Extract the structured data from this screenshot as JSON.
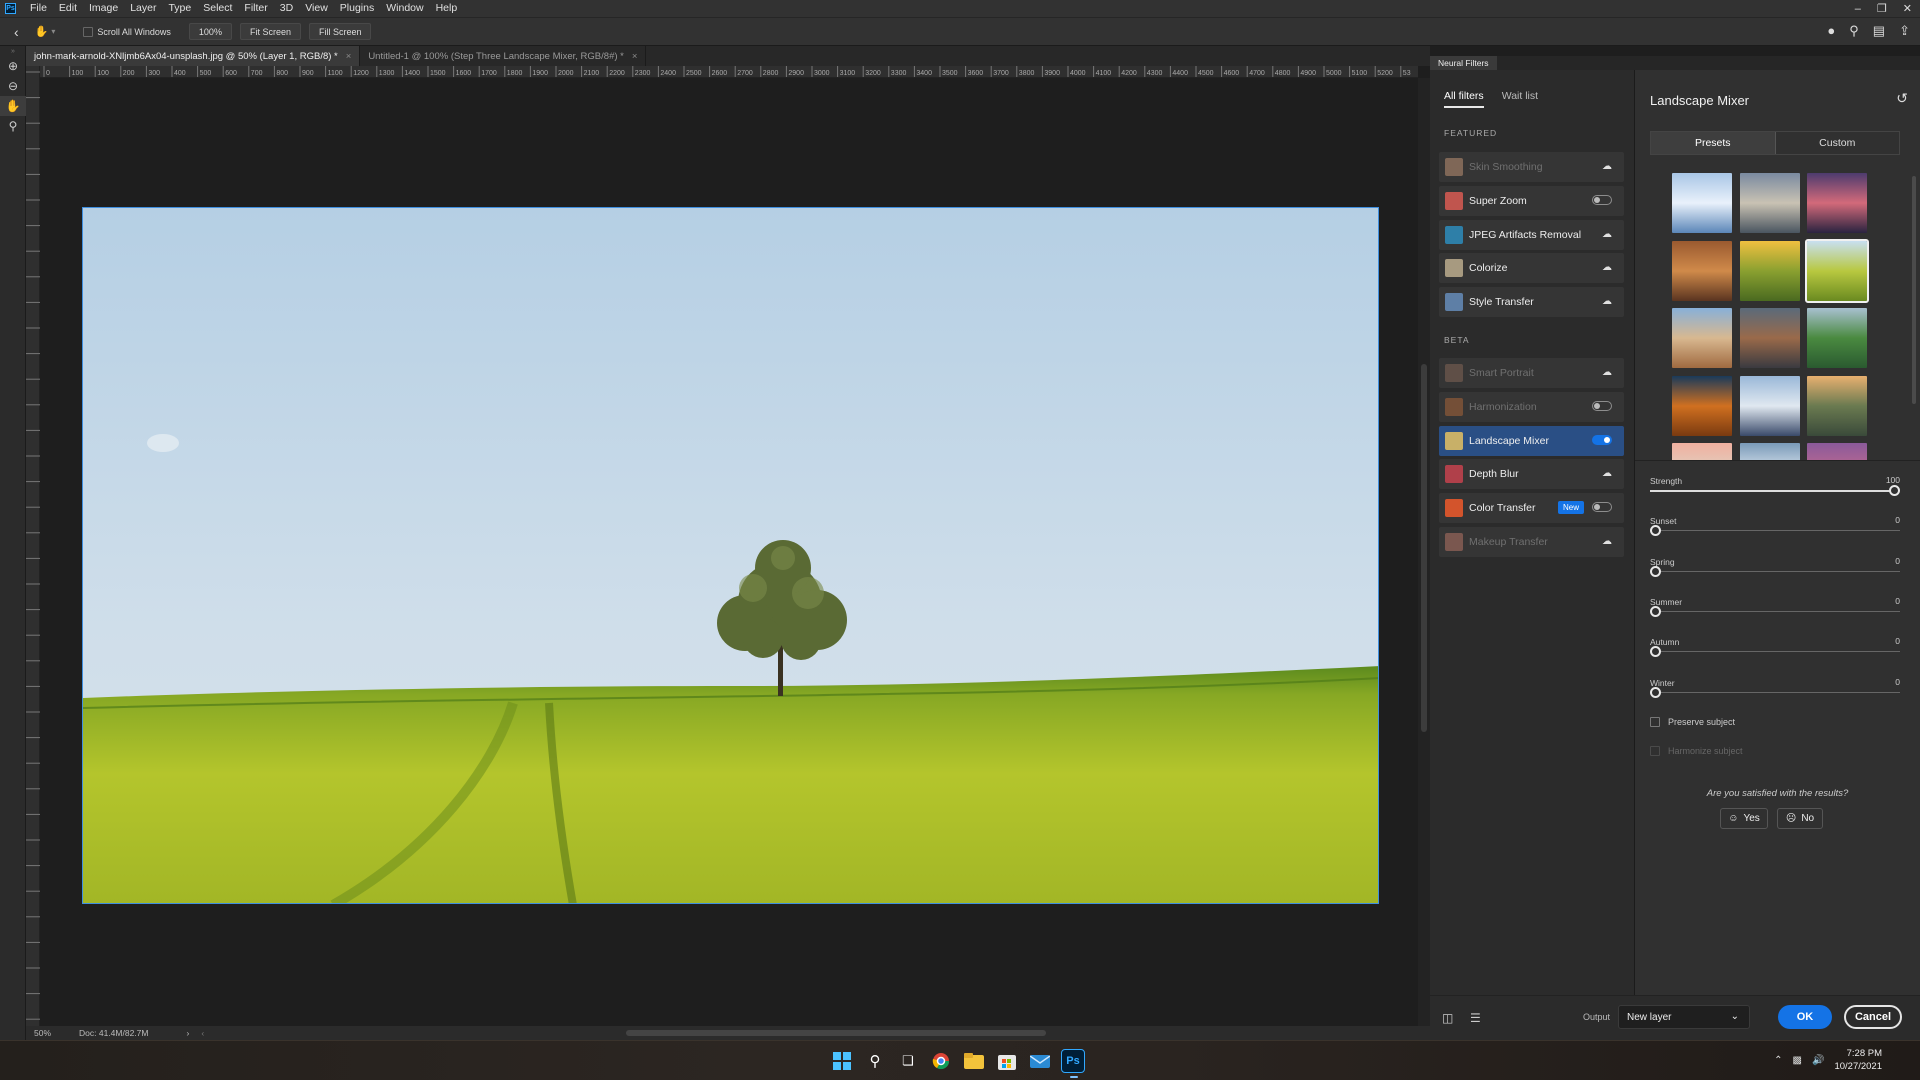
{
  "app": {
    "logo": "Ps",
    "menu": [
      "File",
      "Edit",
      "Image",
      "Layer",
      "Type",
      "Select",
      "Filter",
      "3D",
      "View",
      "Plugins",
      "Window",
      "Help"
    ],
    "window_controls": [
      "minimize-icon",
      "restore-icon",
      "close-icon"
    ]
  },
  "options_bar": {
    "scroll_all_windows": "Scroll All Windows",
    "zoom_value": "100%",
    "fit_screen": "Fit Screen",
    "fill_screen": "Fill Screen"
  },
  "document_tabs": [
    {
      "label": "john-mark-arnold-XNljmb6Ax04-unsplash.jpg @ 50% (Layer 1, RGB/8) *",
      "active": true
    },
    {
      "label": "Untitled-1 @ 100% (Step Three Landscape Mixer, RGB/8#) *",
      "active": false
    }
  ],
  "ruler": {
    "h_ticks": [
      "0",
      "100",
      "100",
      "200",
      "300",
      "400",
      "500",
      "600",
      "700",
      "800",
      "900",
      "1100",
      "1200",
      "1300",
      "1400",
      "1500",
      "1600",
      "1700",
      "1800",
      "1900",
      "2000",
      "2100",
      "2200",
      "2300",
      "2400",
      "2500",
      "2600",
      "2700",
      "2800",
      "2900",
      "3000",
      "3100",
      "3200",
      "3300",
      "3400",
      "3500",
      "3600",
      "3700",
      "3800",
      "3900",
      "4000",
      "4100",
      "4200",
      "4300",
      "4400",
      "4500",
      "4600",
      "4700",
      "4800",
      "4900",
      "5000",
      "5100",
      "5200",
      "53"
    ]
  },
  "status": {
    "zoom": "50%",
    "doc": "Doc: 41.4M/82.7M"
  },
  "neural_filters": {
    "panel_title": "Neural Filters",
    "tabs": {
      "all": "All filters",
      "wait": "Wait list"
    },
    "featured_title": "FEATURED",
    "beta_title": "BETA",
    "featured": [
      {
        "label": "Skin Smoothing",
        "control": "cloud",
        "disabled": true,
        "color": "#c99a7a"
      },
      {
        "label": "Super Zoom",
        "control": "toggle-off",
        "disabled": false,
        "color": "#c0554e"
      },
      {
        "label": "JPEG Artifacts Removal",
        "control": "cloud",
        "disabled": false,
        "color": "#2e7fa8"
      },
      {
        "label": "Colorize",
        "control": "cloud",
        "disabled": false,
        "color": "#a79a80"
      },
      {
        "label": "Style Transfer",
        "control": "cloud",
        "disabled": false,
        "color": "#5e7fa6"
      }
    ],
    "beta": [
      {
        "label": "Smart Portrait",
        "control": "cloud",
        "disabled": true,
        "color": "#8a6a5a"
      },
      {
        "label": "Harmonization",
        "control": "toggle-off",
        "disabled": true,
        "color": "#b46a3a"
      },
      {
        "label": "Landscape Mixer",
        "control": "toggle-on",
        "disabled": false,
        "active": true,
        "color": "#c8b068"
      },
      {
        "label": "Depth Blur",
        "control": "cloud",
        "disabled": false,
        "color": "#b0404a"
      },
      {
        "label": "Color Transfer",
        "control": "toggle-off",
        "disabled": false,
        "badge": "New",
        "color": "#d3542c"
      },
      {
        "label": "Makeup Transfer",
        "control": "cloud",
        "disabled": true,
        "color": "#c07a6a"
      }
    ],
    "settings": {
      "title": "Landscape Mixer",
      "segments": [
        "Presets",
        "Custom"
      ],
      "presets": [
        {
          "colors": [
            "#a9c6e6",
            "#e9f1fb",
            "#5b86b8"
          ]
        },
        {
          "colors": [
            "#7a8aa0",
            "#c9c2b3",
            "#4a5560"
          ]
        },
        {
          "colors": [
            "#4d3b6e",
            "#d36a7a",
            "#2a2340"
          ]
        },
        {
          "colors": [
            "#9a5a30",
            "#d08a4a",
            "#5a3420"
          ]
        },
        {
          "colors": [
            "#f0c040",
            "#8aa030",
            "#4a6a20"
          ]
        },
        {
          "colors": [
            "#c8dff0",
            "#b8c840",
            "#6a8a20"
          ],
          "selected": true
        },
        {
          "colors": [
            "#88b0d8",
            "#d8b890",
            "#a06a40"
          ]
        },
        {
          "colors": [
            "#5a6a7a",
            "#9a6a4a",
            "#3a3a40"
          ]
        },
        {
          "colors": [
            "#a8c0d0",
            "#4a8a40",
            "#2a5a30"
          ]
        },
        {
          "colors": [
            "#1a3a5a",
            "#d07020",
            "#7a3a10"
          ]
        },
        {
          "colors": [
            "#9ab8d8",
            "#e0e8f0",
            "#3a4a6a"
          ]
        },
        {
          "colors": [
            "#e8b070",
            "#6a7a50",
            "#3a4a3a"
          ]
        },
        {
          "colors": [
            "#f0b0a0",
            "#e0d0c0",
            "#a07060"
          ]
        },
        {
          "colors": [
            "#7a9ab8",
            "#dbe6f0",
            "#4a5a70"
          ]
        },
        {
          "colors": [
            "#8a5a9a",
            "#c06a90",
            "#3a2a50"
          ]
        }
      ],
      "sliders": [
        {
          "label": "Strength",
          "value": "100",
          "fraction": 1.0
        },
        {
          "label": "Sunset",
          "value": "0",
          "fraction": 0.0
        },
        {
          "label": "Spring",
          "value": "0",
          "fraction": 0.0
        },
        {
          "label": "Summer",
          "value": "0",
          "fraction": 0.0
        },
        {
          "label": "Autumn",
          "value": "0",
          "fraction": 0.0
        },
        {
          "label": "Winter",
          "value": "0",
          "fraction": 0.0
        }
      ],
      "preserve_subject": "Preserve subject",
      "harmonize_subject": "Harmonize subject",
      "satisfied_q": "Are you satisfied with the results?",
      "yes": "Yes",
      "no": "No"
    },
    "footer": {
      "output_label": "Output",
      "output_value": "New layer",
      "ok": "OK",
      "cancel": "Cancel"
    }
  },
  "taskbar": {
    "time": "7:28 PM",
    "date": "10/27/2021",
    "ps_label": "Ps"
  },
  "colors": {
    "accent": "#1473e6",
    "selection_border": "#3f8fe0"
  }
}
